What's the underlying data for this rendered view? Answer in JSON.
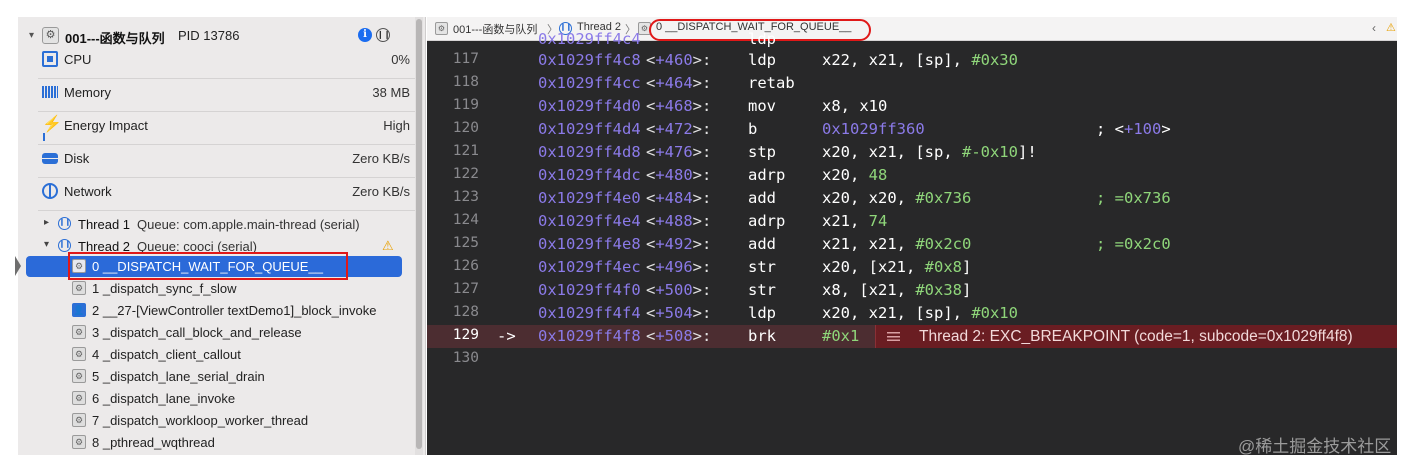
{
  "navigator": {
    "process": {
      "name": "001---函数与队列",
      "pid": "PID 13786"
    },
    "gauges": [
      {
        "label": "CPU",
        "value": "0%",
        "icon": "cpu-icon"
      },
      {
        "label": "Memory",
        "value": "38 MB",
        "icon": "memory-icon"
      },
      {
        "label": "Energy Impact",
        "value": "High",
        "icon": "energy-icon"
      },
      {
        "label": "Disk",
        "value": "Zero KB/s",
        "icon": "disk-icon"
      },
      {
        "label": "Network",
        "value": "Zero KB/s",
        "icon": "network-icon"
      }
    ],
    "threads": [
      {
        "name": "Thread 1",
        "queue": "Queue: com.apple.main-thread (serial)",
        "expanded": false
      },
      {
        "name": "Thread 2",
        "queue": "Queue: cooci (serial)",
        "expanded": true
      }
    ],
    "frames": [
      "0 __DISPATCH_WAIT_FOR_QUEUE__",
      "1 _dispatch_sync_f_slow",
      "2 __27-[ViewController textDemo1]_block_invoke",
      "3 _dispatch_call_block_and_release",
      "4 _dispatch_client_callout",
      "5 _dispatch_lane_serial_drain",
      "6 _dispatch_lane_invoke",
      "7 _dispatch_workloop_worker_thread",
      "8 _pthread_wqthread"
    ],
    "selected_frame": 0
  },
  "jumpbar": {
    "crumbs": [
      "001---函数与队列",
      "Thread 2",
      "0 __DISPATCH_WAIT_FOR_QUEUE__"
    ]
  },
  "code": {
    "lines": [
      {
        "ln": "117",
        "addr": "0x1029ff4c8",
        "off": "+460",
        "op": "ldp",
        "a1": "x22, x21, [sp], ",
        "a2": "#0x30"
      },
      {
        "ln": "118",
        "addr": "0x1029ff4cc",
        "off": "+464",
        "op": "retab",
        "a1": "",
        "a2": ""
      },
      {
        "ln": "119",
        "addr": "0x1029ff4d0",
        "off": "+468",
        "op": "mov",
        "a1": "x8, x10",
        "a2": ""
      },
      {
        "ln": "120",
        "addr": "0x1029ff4d4",
        "off": "+472",
        "op": "b",
        "a1": "",
        "a2": "0x1029ff360"
      },
      {
        "ln": "121",
        "addr": "0x1029ff4d8",
        "off": "+476",
        "op": "stp",
        "a1": "x20, x21, [sp, ",
        "a2": "#-0x10",
        "a3": "]!"
      },
      {
        "ln": "122",
        "addr": "0x1029ff4dc",
        "off": "+480",
        "op": "adrp",
        "a1": "x20, ",
        "a2": "48"
      },
      {
        "ln": "123",
        "addr": "0x1029ff4e0",
        "off": "+484",
        "op": "add",
        "a1": "x20, x20, ",
        "a2": "#0x736"
      },
      {
        "ln": "124",
        "addr": "0x1029ff4e4",
        "off": "+488",
        "op": "adrp",
        "a1": "x21, ",
        "a2": "74"
      },
      {
        "ln": "125",
        "addr": "0x1029ff4e8",
        "off": "+492",
        "op": "add",
        "a1": "x21, x21, ",
        "a2": "#0x2c0"
      },
      {
        "ln": "126",
        "addr": "0x1029ff4ec",
        "off": "+496",
        "op": "str",
        "a1": "x20, [x21, ",
        "a2": "#0x8",
        "a3": "]"
      },
      {
        "ln": "127",
        "addr": "0x1029ff4f0",
        "off": "+500",
        "op": "str",
        "a1": "x8, [x21, ",
        "a2": "#0x38",
        "a3": "]"
      },
      {
        "ln": "128",
        "addr": "0x1029ff4f4",
        "off": "+504",
        "op": "ldp",
        "a1": "x20, x21, [sp], ",
        "a2": "#0x10"
      },
      {
        "ln": "129",
        "addr": "0x1029ff4f8",
        "off": "+508",
        "op": "brk",
        "a1": "",
        "a2": "#0x1"
      },
      {
        "ln": "130"
      }
    ],
    "comments": {
      "120": "; <+100>",
      "123": "; =0x736",
      "125": "; =0x2c0"
    },
    "current_line_arrow": "->",
    "breakpoint_message": "Thread 2: EXC_BREAKPOINT (code=1, subcode=0x1029ff4f8)"
  },
  "watermark": "@稀土掘金技术社区",
  "colors": {
    "accent": "#2b6ad9",
    "address": "#8b7ae8",
    "number": "#8fd67a",
    "error_bg": "#6a1d22",
    "editor_bg": "#282829"
  }
}
